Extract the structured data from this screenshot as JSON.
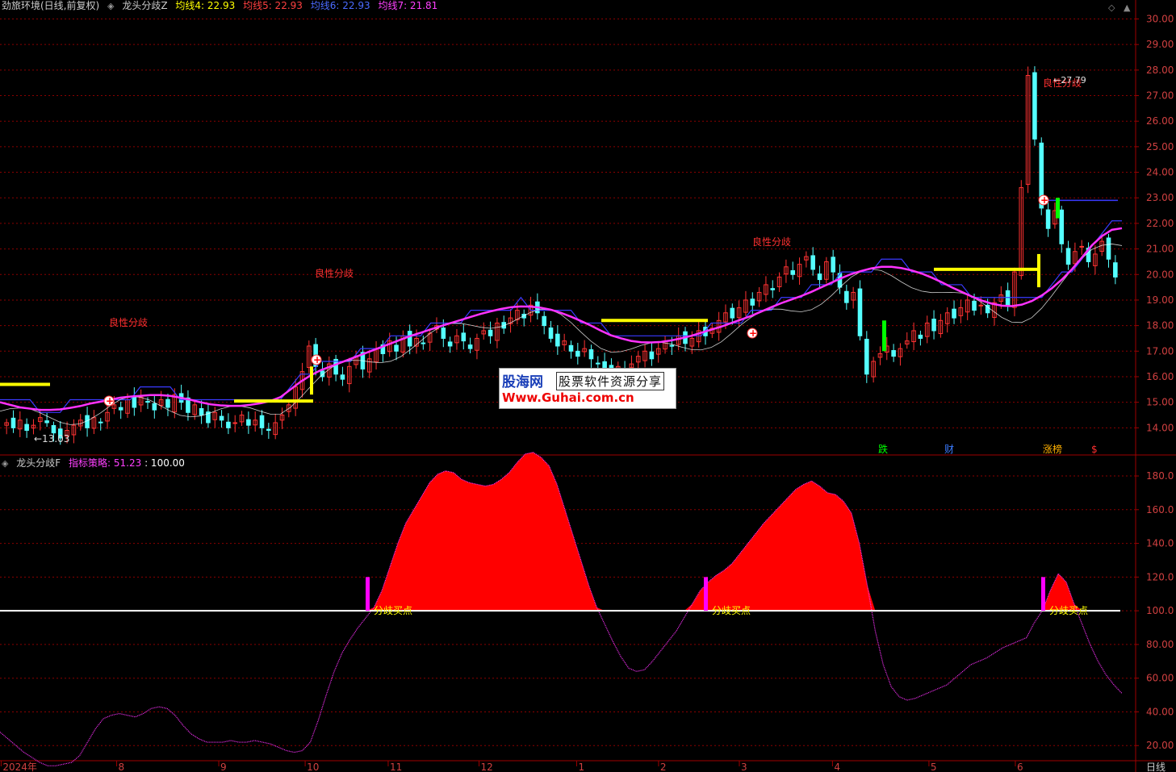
{
  "header": {
    "stock": "劲旅环境(日线,前复权)",
    "indicator": "龙头分歧Z",
    "ma4": "均线4: 22.93",
    "ma5": "均线5: 22.93",
    "ma6": "均线6: 22.93",
    "ma7": "均线7: 21.81"
  },
  "sub_header": {
    "indicator": "龙头分歧F",
    "strategy": "指标策略: 51.23",
    "level": ": 100.00"
  },
  "colors": {
    "up": "#ff3232",
    "down": "#54ffff",
    "ma_main": "#ff32ff",
    "ma_blue": "#3a3aff",
    "yellow": "#ffff00",
    "green": "#00ff00",
    "fill": "#ff0000",
    "grid": "#8b0000"
  },
  "watermark": {
    "line1": "股海网",
    "line1b": "股票软件资源分享",
    "line2": "Www.Guhai.com.cn"
  },
  "chart_data": [
    {
      "type": "candlestick",
      "title": "龙头分歧Z",
      "ylim": [
        13.0,
        30.3
      ],
      "y_ticks": [
        "30.00",
        "29.00",
        "28.00",
        "27.00",
        "26.00",
        "25.00",
        "24.00",
        "23.00",
        "22.00",
        "21.00",
        "20.00",
        "19.00",
        "18.00",
        "17.00",
        "16.00",
        "15.00",
        "14.00"
      ],
      "x_tick_labels": [
        "2024年",
        "8",
        "9",
        "10",
        "11",
        "12",
        "1",
        "2",
        "3",
        "4",
        "5",
        "6"
      ],
      "annotations": [
        "良性分歧",
        "良性分歧",
        "良性分歧",
        "良性分歧"
      ],
      "price_labels": [
        "13.03",
        "27.79"
      ],
      "event_markers": [
        "跌",
        "财",
        "涨榜",
        "$"
      ],
      "candles_close": [
        14.2,
        14.0,
        14.3,
        13.9,
        14.1,
        14.4,
        14.2,
        13.8,
        13.6,
        13.9,
        14.1,
        14.3,
        14.0,
        14.4,
        14.2,
        14.6,
        14.9,
        14.7,
        15.1,
        14.8,
        15.2,
        15.0,
        14.7,
        15.1,
        14.8,
        15.3,
        15.0,
        14.6,
        14.9,
        14.5,
        14.2,
        14.6,
        14.3,
        14.0,
        14.2,
        14.5,
        14.1,
        14.3,
        14.0,
        13.9,
        14.2,
        14.5,
        14.9,
        15.6,
        16.2,
        17.2,
        16.4,
        16.0,
        16.5,
        16.1,
        15.9,
        16.4,
        16.8,
        16.3,
        16.7,
        17.1,
        16.9,
        17.4,
        17.0,
        17.6,
        17.2,
        17.5,
        17.3,
        17.7,
        18.0,
        17.5,
        17.2,
        17.6,
        17.4,
        17.1,
        17.5,
        17.8,
        17.6,
        18.1,
        17.9,
        18.3,
        18.6,
        18.3,
        18.8,
        18.5,
        18.0,
        17.5,
        17.2,
        17.4,
        17.0,
        16.8,
        17.1,
        16.7,
        16.5,
        16.3,
        16.1,
        16.4,
        16.2,
        16.5,
        16.8,
        17.0,
        16.7,
        17.1,
        17.4,
        17.2,
        17.6,
        17.3,
        17.5,
        17.8,
        17.6,
        17.9,
        18.2,
        18.5,
        18.3,
        18.7,
        19.0,
        18.8,
        19.3,
        19.6,
        19.4,
        19.9,
        20.3,
        20.0,
        20.4,
        20.7,
        20.2,
        19.8,
        20.5,
        20.1,
        19.5,
        18.9,
        19.3,
        17.6,
        16.1,
        16.6,
        16.9,
        17.2,
        16.8,
        17.1,
        17.4,
        17.8,
        17.5,
        18.1,
        17.8,
        18.2,
        18.5,
        18.3,
        18.7,
        19.0,
        18.6,
        18.8,
        18.5,
        18.9,
        19.2,
        18.8,
        20.1,
        23.4,
        27.79,
        25.3,
        22.6,
        21.8,
        22.5,
        21.2,
        20.4,
        20.9,
        21.1,
        20.5,
        20.8,
        21.3,
        20.6,
        19.9
      ],
      "ma_main_close": [
        15.0,
        14.9,
        14.8,
        14.75,
        14.7,
        14.7,
        14.72,
        14.78,
        14.85,
        14.95,
        15.02,
        15.1,
        15.18,
        15.22,
        15.25,
        15.28,
        15.28,
        15.25,
        15.18,
        15.1,
        15.0,
        14.92,
        14.88,
        14.86,
        14.86,
        14.9,
        14.96,
        15.05,
        15.2,
        15.5,
        15.8,
        16.05,
        16.25,
        16.4,
        16.55,
        16.7,
        16.85,
        17.0,
        17.15,
        17.3,
        17.45,
        17.6,
        17.72,
        17.85,
        17.98,
        18.1,
        18.22,
        18.34,
        18.46,
        18.56,
        18.65,
        18.72,
        18.75,
        18.74,
        18.7,
        18.62,
        18.5,
        18.35,
        18.18,
        18.0,
        17.8,
        17.62,
        17.5,
        17.4,
        17.35,
        17.34,
        17.36,
        17.42,
        17.5,
        17.6,
        17.72,
        17.84,
        17.96,
        18.1,
        18.24,
        18.38,
        18.55,
        18.72,
        18.88,
        19.02,
        19.16,
        19.32,
        19.5,
        19.68,
        19.86,
        20.02,
        20.14,
        20.24,
        20.3,
        20.3,
        20.25,
        20.16,
        20.04,
        19.88,
        19.7,
        19.5,
        19.32,
        19.14,
        18.98,
        18.86,
        18.78,
        18.76,
        18.82,
        18.96,
        19.18,
        19.46,
        19.8,
        20.2,
        20.66,
        21.14,
        21.5,
        21.75,
        21.81
      ]
    },
    {
      "type": "area",
      "title": "龙头分歧F",
      "ylim": [
        11.5,
        191.5
      ],
      "y_ticks": [
        "180.0",
        "160.0",
        "140.0",
        "120.0",
        "100.0",
        "80.00",
        "60.00",
        "40.00",
        "20.00"
      ],
      "threshold": 100.0,
      "signal_label": "分歧买点",
      "strategy_value": 51.23,
      "values": [
        28,
        24,
        20,
        16,
        13,
        10,
        8,
        8,
        9,
        10,
        14,
        22,
        30,
        36,
        38,
        39,
        38,
        37,
        39,
        42,
        43,
        42,
        38,
        32,
        27,
        24,
        22,
        22,
        22,
        23,
        22,
        22,
        23,
        22,
        21,
        19,
        17,
        16,
        17,
        22,
        35,
        50,
        64,
        75,
        83,
        90,
        96,
        102,
        112,
        126,
        140,
        152,
        160,
        168,
        176,
        181,
        183,
        182,
        178,
        176,
        175,
        174,
        175,
        178,
        182,
        188,
        193,
        194,
        191,
        186,
        175,
        160,
        145,
        130,
        115,
        102,
        92,
        82,
        73,
        66,
        64,
        65,
        70,
        76,
        82,
        88,
        96,
        104,
        112,
        117,
        121,
        124,
        128,
        134,
        140,
        146,
        152,
        157,
        162,
        167,
        172,
        175,
        177,
        174,
        170,
        169,
        165,
        158,
        140,
        115,
        88,
        68,
        55,
        49,
        47,
        48,
        50,
        52,
        54,
        56,
        60,
        64,
        68,
        70,
        72,
        75,
        78,
        80,
        82,
        84,
        93,
        100,
        112,
        122,
        117,
        104,
        92,
        80,
        70,
        62,
        56,
        51
      ]
    }
  ]
}
